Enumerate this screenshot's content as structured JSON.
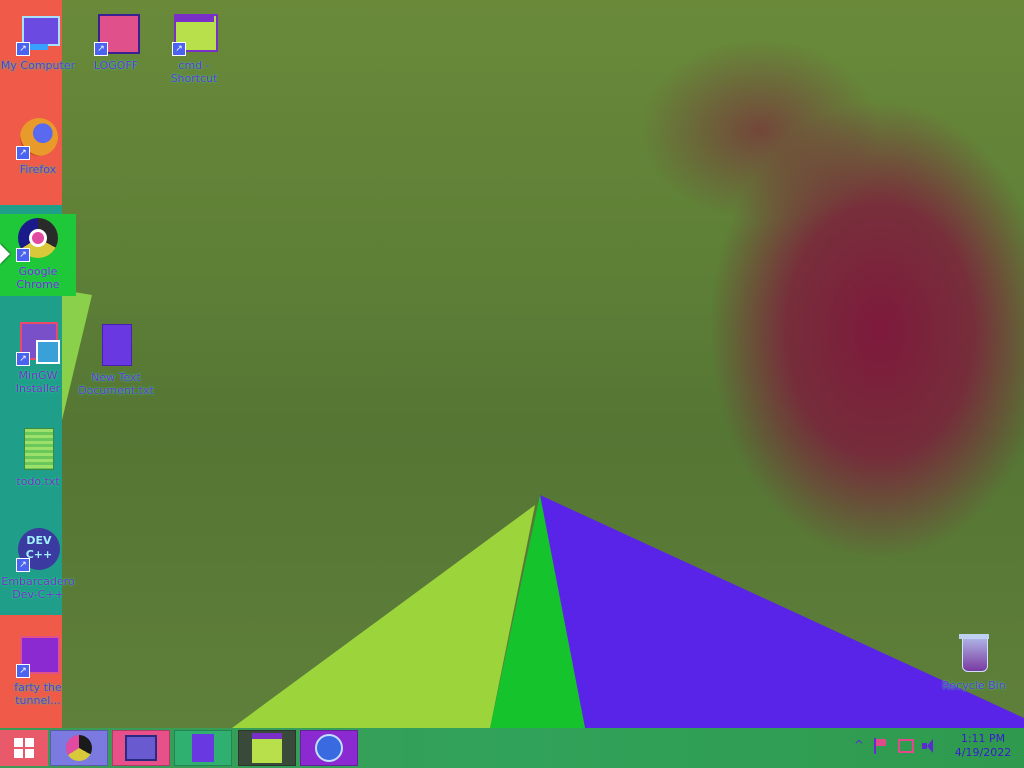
{
  "desktop": {
    "icons": [
      {
        "label": "My Computer",
        "icon": "computer-icon"
      },
      {
        "label": "LOGOFF",
        "icon": "logoff-icon"
      },
      {
        "label": "cmd - Shortcut",
        "icon": "cmd-icon"
      },
      {
        "label": "Firefox",
        "icon": "firefox-icon"
      },
      {
        "label": "Google Chrome",
        "icon": "chrome-icon"
      },
      {
        "label": "MinGW Installer",
        "icon": "installer-icon"
      },
      {
        "label": "New Text Document.txt",
        "icon": "text-document-icon"
      },
      {
        "label": "todo.txt",
        "icon": "text-file-icon"
      },
      {
        "label": "Embarcadero Dev-C++",
        "icon": "devcpp-icon"
      },
      {
        "label": "farty the tunnel...",
        "icon": "folder-icon"
      },
      {
        "label": "Recycle Bin",
        "icon": "recycle-bin-icon"
      }
    ]
  },
  "taskbar": {
    "start": "windows-start-icon",
    "pinned": [
      "chrome-icon",
      "printer-icon",
      "file-icon",
      "cmd-icon",
      "media-player-icon"
    ],
    "tray": {
      "chevron": "^",
      "flag": "flag-icon",
      "network": "network-icon",
      "volume": "volume-icon"
    },
    "clock": {
      "time": "1:11 PM",
      "date": "4/19/2022"
    }
  }
}
